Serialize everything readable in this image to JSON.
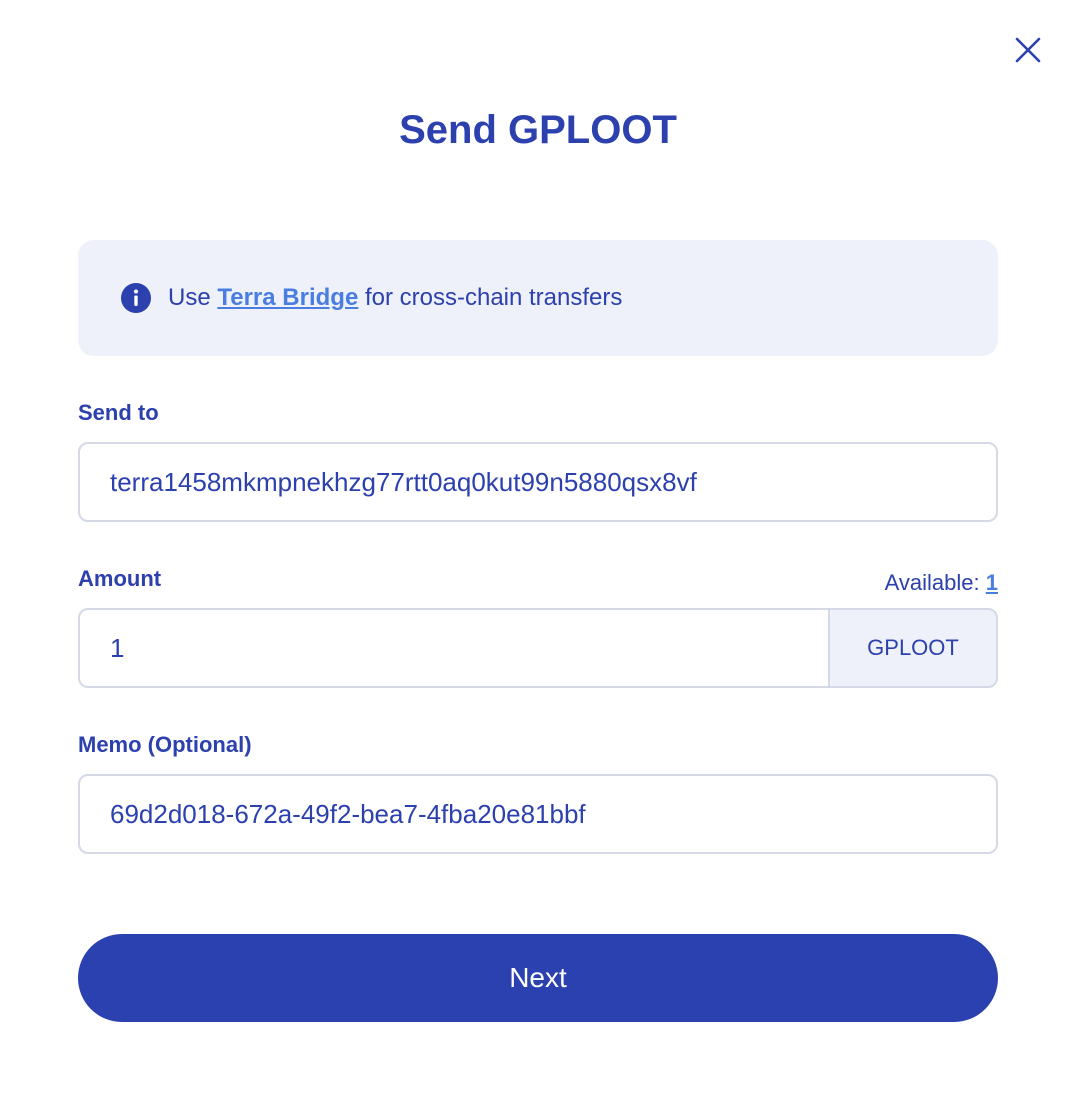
{
  "modal": {
    "title": "Send GPLOOT"
  },
  "notice": {
    "prefix": "Use ",
    "link": "Terra Bridge",
    "suffix": " for cross-chain transfers",
    "icon": "info-icon"
  },
  "send_to": {
    "label": "Send to",
    "value": "terra1458mkmpnekhzg77rtt0aq0kut99n5880qsx8vf"
  },
  "amount": {
    "label": "Amount",
    "value": "1",
    "unit": "GPLOOT",
    "available_label": "Available:",
    "available_value": "1"
  },
  "memo": {
    "label": "Memo (Optional)",
    "value": "69d2d018-672a-49f2-bea7-4fba20e81bbf"
  },
  "next_button": {
    "label": "Next"
  },
  "colors": {
    "primary": "#2c40ae",
    "link": "#4a7de0",
    "notice_bg": "#eef1f9",
    "border": "#d5d9e6"
  }
}
